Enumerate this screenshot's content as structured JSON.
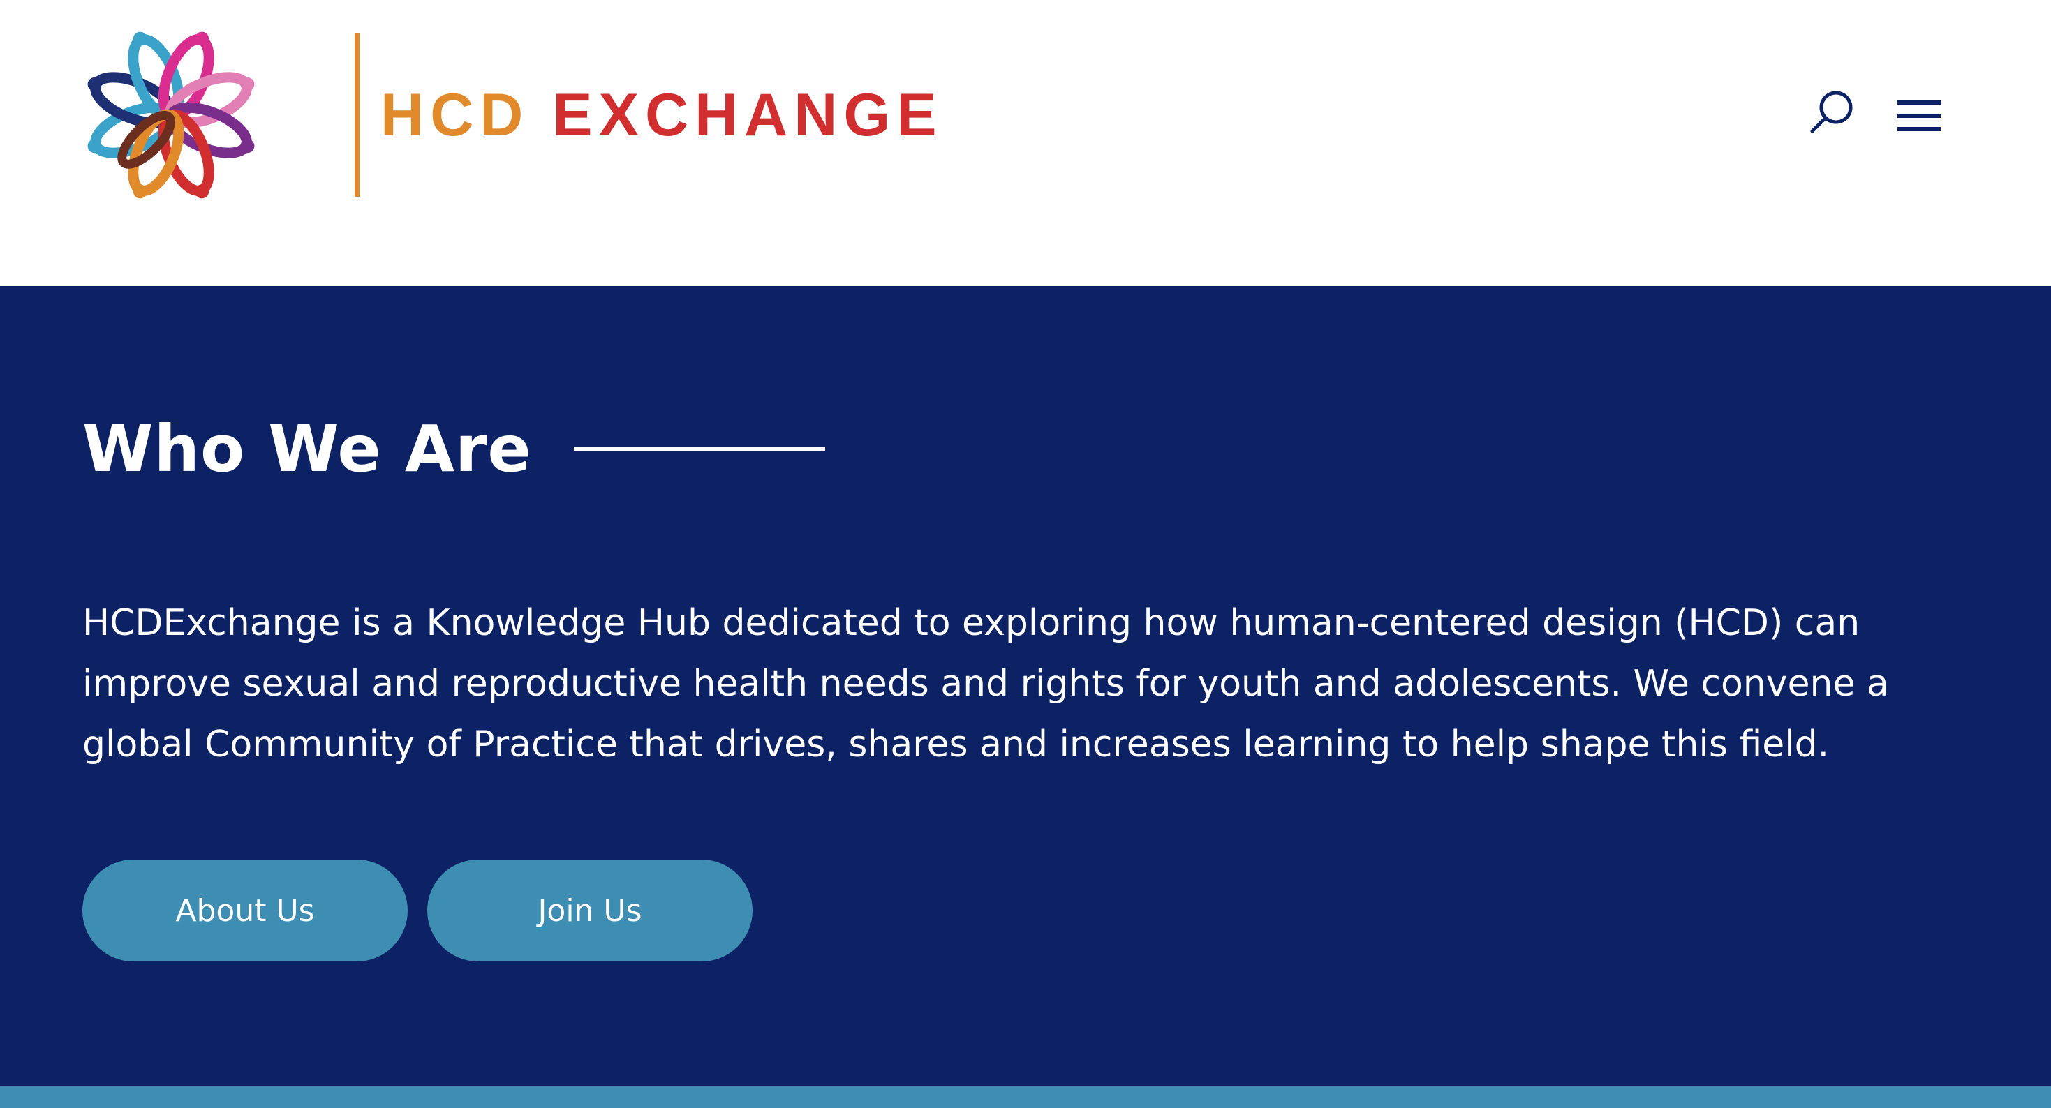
{
  "header": {
    "logo": {
      "text_part1": "HCD",
      "text_part2": "EXCHANGE",
      "colors": {
        "hcd": "#e08a2c",
        "exchange": "#d12f2f",
        "divider": "#e08a2c",
        "petals": [
          "#3ba2c9",
          "#d92e8f",
          "#e27fb5",
          "#7a2e8c",
          "#d12f2f",
          "#e08a2c",
          "#6b2e1f",
          "#1e2f73"
        ]
      }
    },
    "icons": {
      "search": "search-icon",
      "menu": "hamburger-menu-icon"
    }
  },
  "hero": {
    "title": "Who We Are",
    "description": "HCDExchange is a Knowledge Hub dedicated to exploring how human-centered design (HCD) can improve sexual and reproductive health needs and rights for youth and adolescents. We convene a global Community of Practice that drives, shares and increases learning to help shape this field.",
    "buttons": {
      "about": "About Us",
      "join": "Join Us"
    },
    "colors": {
      "background": "#0c2264",
      "button": "#3e8db3",
      "text": "#ffffff"
    }
  }
}
